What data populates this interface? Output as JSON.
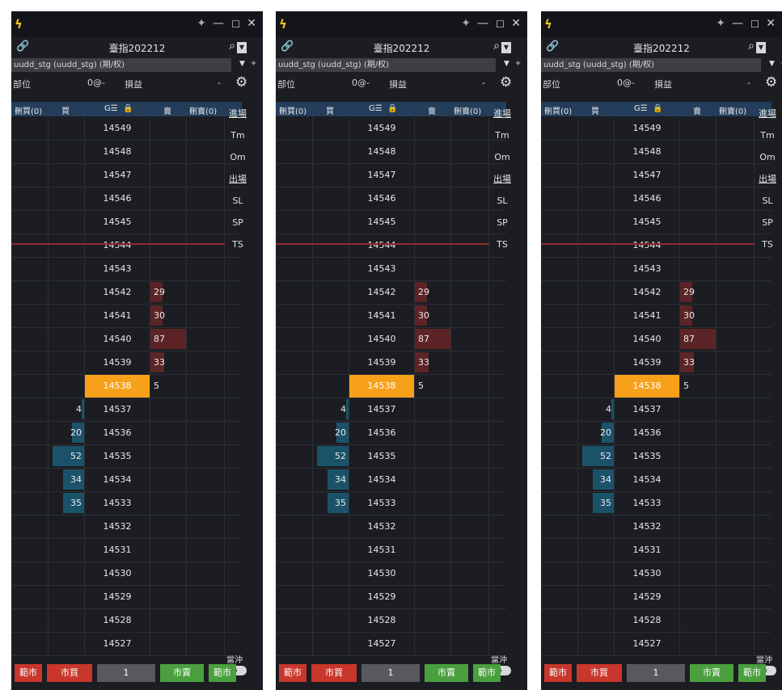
{
  "windows": [
    {
      "window_title": "",
      "symbol": "臺指202212",
      "account": "uudd_stg (uudd_stg) (期/权)"
    },
    {
      "window_title": "",
      "symbol": "臺指202212",
      "account": "uudd_stg (uudd_stg) (期/权)"
    },
    {
      "window_title": "",
      "symbol": "臺指202212",
      "account": "uudd_stg (uudd_stg) (期/权)"
    }
  ],
  "position": {
    "label": "部位",
    "value": "0@-",
    "pnl_label": "損益",
    "pnl_value": "-"
  },
  "columns": {
    "del_buy": "刪買(0)",
    "buy": "買",
    "price": "G☰",
    "sell": "賣",
    "del_sell": "刪賣(0)"
  },
  "side_panel": {
    "entry": "進場",
    "tm": "Tm",
    "om": "Om",
    "exit": "出場",
    "sl": "SL",
    "sp": "SP",
    "ts": "TS",
    "flat": "當沖"
  },
  "buttons": {
    "close_buy": "範市",
    "market_buy": "市買",
    "quantity": "1",
    "market_sell": "市賣",
    "close_sell": "範市"
  },
  "ladder": [
    {
      "price": "14549",
      "bid": "",
      "ask": ""
    },
    {
      "price": "14548",
      "bid": "",
      "ask": ""
    },
    {
      "price": "14547",
      "bid": "",
      "ask": ""
    },
    {
      "price": "14546",
      "bid": "",
      "ask": ""
    },
    {
      "price": "14545",
      "bid": "",
      "ask": ""
    },
    {
      "price": "14544",
      "bid": "",
      "ask": ""
    },
    {
      "price": "14543",
      "bid": "",
      "ask": ""
    },
    {
      "price": "14542",
      "bid": "",
      "ask": "29"
    },
    {
      "price": "14541",
      "bid": "",
      "ask": "30"
    },
    {
      "price": "14540",
      "bid": "",
      "ask": "87"
    },
    {
      "price": "14539",
      "bid": "",
      "ask": "33"
    },
    {
      "price": "14538",
      "bid": "",
      "ask": "5",
      "last": true
    },
    {
      "price": "14537",
      "bid": "4",
      "ask": ""
    },
    {
      "price": "14536",
      "bid": "20",
      "ask": ""
    },
    {
      "price": "14535",
      "bid": "52",
      "ask": ""
    },
    {
      "price": "14534",
      "bid": "34",
      "ask": ""
    },
    {
      "price": "14533",
      "bid": "35",
      "ask": ""
    },
    {
      "price": "14532",
      "bid": "",
      "ask": ""
    },
    {
      "price": "14531",
      "bid": "",
      "ask": ""
    },
    {
      "price": "14530",
      "bid": "",
      "ask": ""
    },
    {
      "price": "14529",
      "bid": "",
      "ask": ""
    },
    {
      "price": "14528",
      "bid": "",
      "ask": ""
    },
    {
      "price": "14527",
      "bid": "",
      "ask": ""
    }
  ],
  "colors": {
    "bid_bar": "#1a5369",
    "ask_bar": "#5c2426",
    "last_price": "#f7a11a",
    "market_buy": "#c9362c",
    "market_sell": "#4aa03e"
  }
}
